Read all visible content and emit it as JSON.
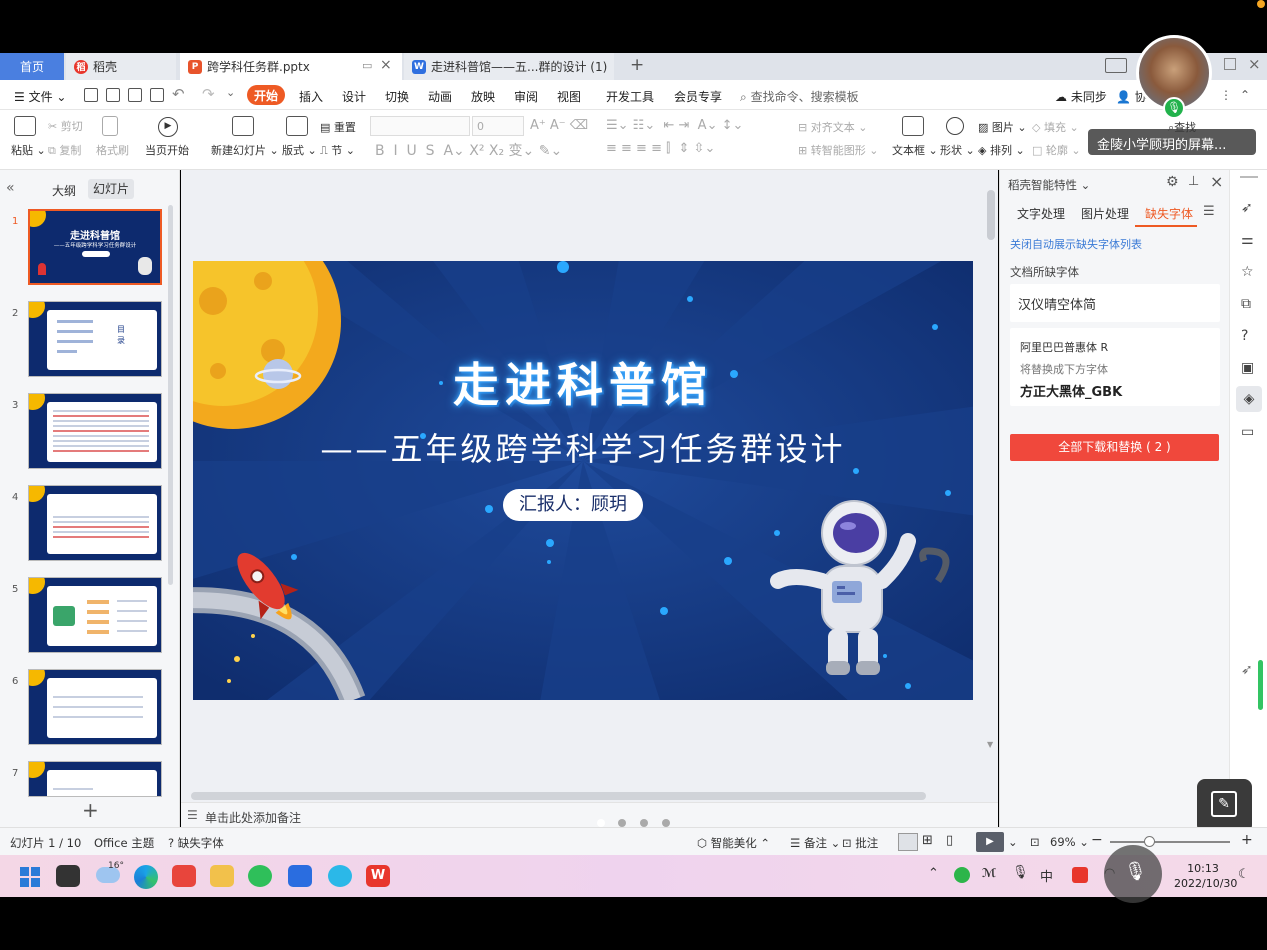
{
  "tabs": {
    "home": "首页",
    "docer": "稻壳",
    "active_file": "跨学科任务群.pptx",
    "web_tab": "走进科普馆——五...群的设计 (1)"
  },
  "menu": {
    "file": "文件",
    "items": [
      "开始",
      "插入",
      "设计",
      "切换",
      "动画",
      "放映",
      "审阅",
      "视图",
      "开发工具",
      "会员专享"
    ],
    "search_placeholder": "查找命令、搜索模板",
    "sync": "未同步",
    "collab": "协"
  },
  "ribbon": {
    "paste": "粘贴",
    "cut": "剪切",
    "copy": "复制",
    "format_painter": "格式刷",
    "from_current": "当页开始",
    "new_slide": "新建幻灯片",
    "layout": "版式",
    "reset": "重置",
    "section": "节",
    "font_size": "0",
    "align_text": "对齐文本",
    "smart_shape": "转智能图形",
    "textbox": "文本框",
    "shape": "形状",
    "picture": "图片",
    "fill": "填充",
    "arrange": "排列",
    "outline": "轮廓",
    "find": "查找"
  },
  "meeting": {
    "caption": "金陵小学顾玥的屏幕..."
  },
  "leftpanel": {
    "outline_tab": "大纲",
    "slides_tab": "幻灯片",
    "slide_numbers": [
      "1",
      "2",
      "3",
      "4",
      "5",
      "6",
      "7"
    ],
    "thumb1_title": "走进科普馆",
    "thumb1_sub": "——五年级跨学科学习任务群设计",
    "thumb2_toc": "目录"
  },
  "slide": {
    "title": "走进科普馆",
    "subtitle": "——五年级跨学科学习任务群设计",
    "presenter": "汇报人：顾玥"
  },
  "notes_placeholder": "单击此处添加备注",
  "rightpanel": {
    "header": "稻壳智能特性",
    "tabs": [
      "文字处理",
      "图片处理",
      "缺失字体"
    ],
    "toggle_link": "关闭自动展示缺失字体列表",
    "section_label": "文档所缺字体",
    "font1": "汉仪晴空体简",
    "font2": "阿里巴巴普惠体 R",
    "replace_hint": "将替换成下方字体",
    "replacement": "方正大黑体_GBK",
    "button": "全部下载和替换 ( 2 )"
  },
  "statusbar": {
    "slide_count": "幻灯片 1 / 10",
    "theme": "Office 主题",
    "missing_font": "缺失字体",
    "smart_beautify": "智能美化",
    "notes": "备注",
    "comments": "批注",
    "zoom": "69%"
  },
  "taskbar": {
    "weather": "16°",
    "ime": "中",
    "time": "10:13",
    "date": "2022/10/30"
  },
  "colors": {
    "accent_orange": "#ee5a24",
    "replace_button": "#f0483c",
    "tab_home": "#4a7fe0",
    "slide_bg": "#173a86",
    "link_blue": "#3b7bd6"
  }
}
